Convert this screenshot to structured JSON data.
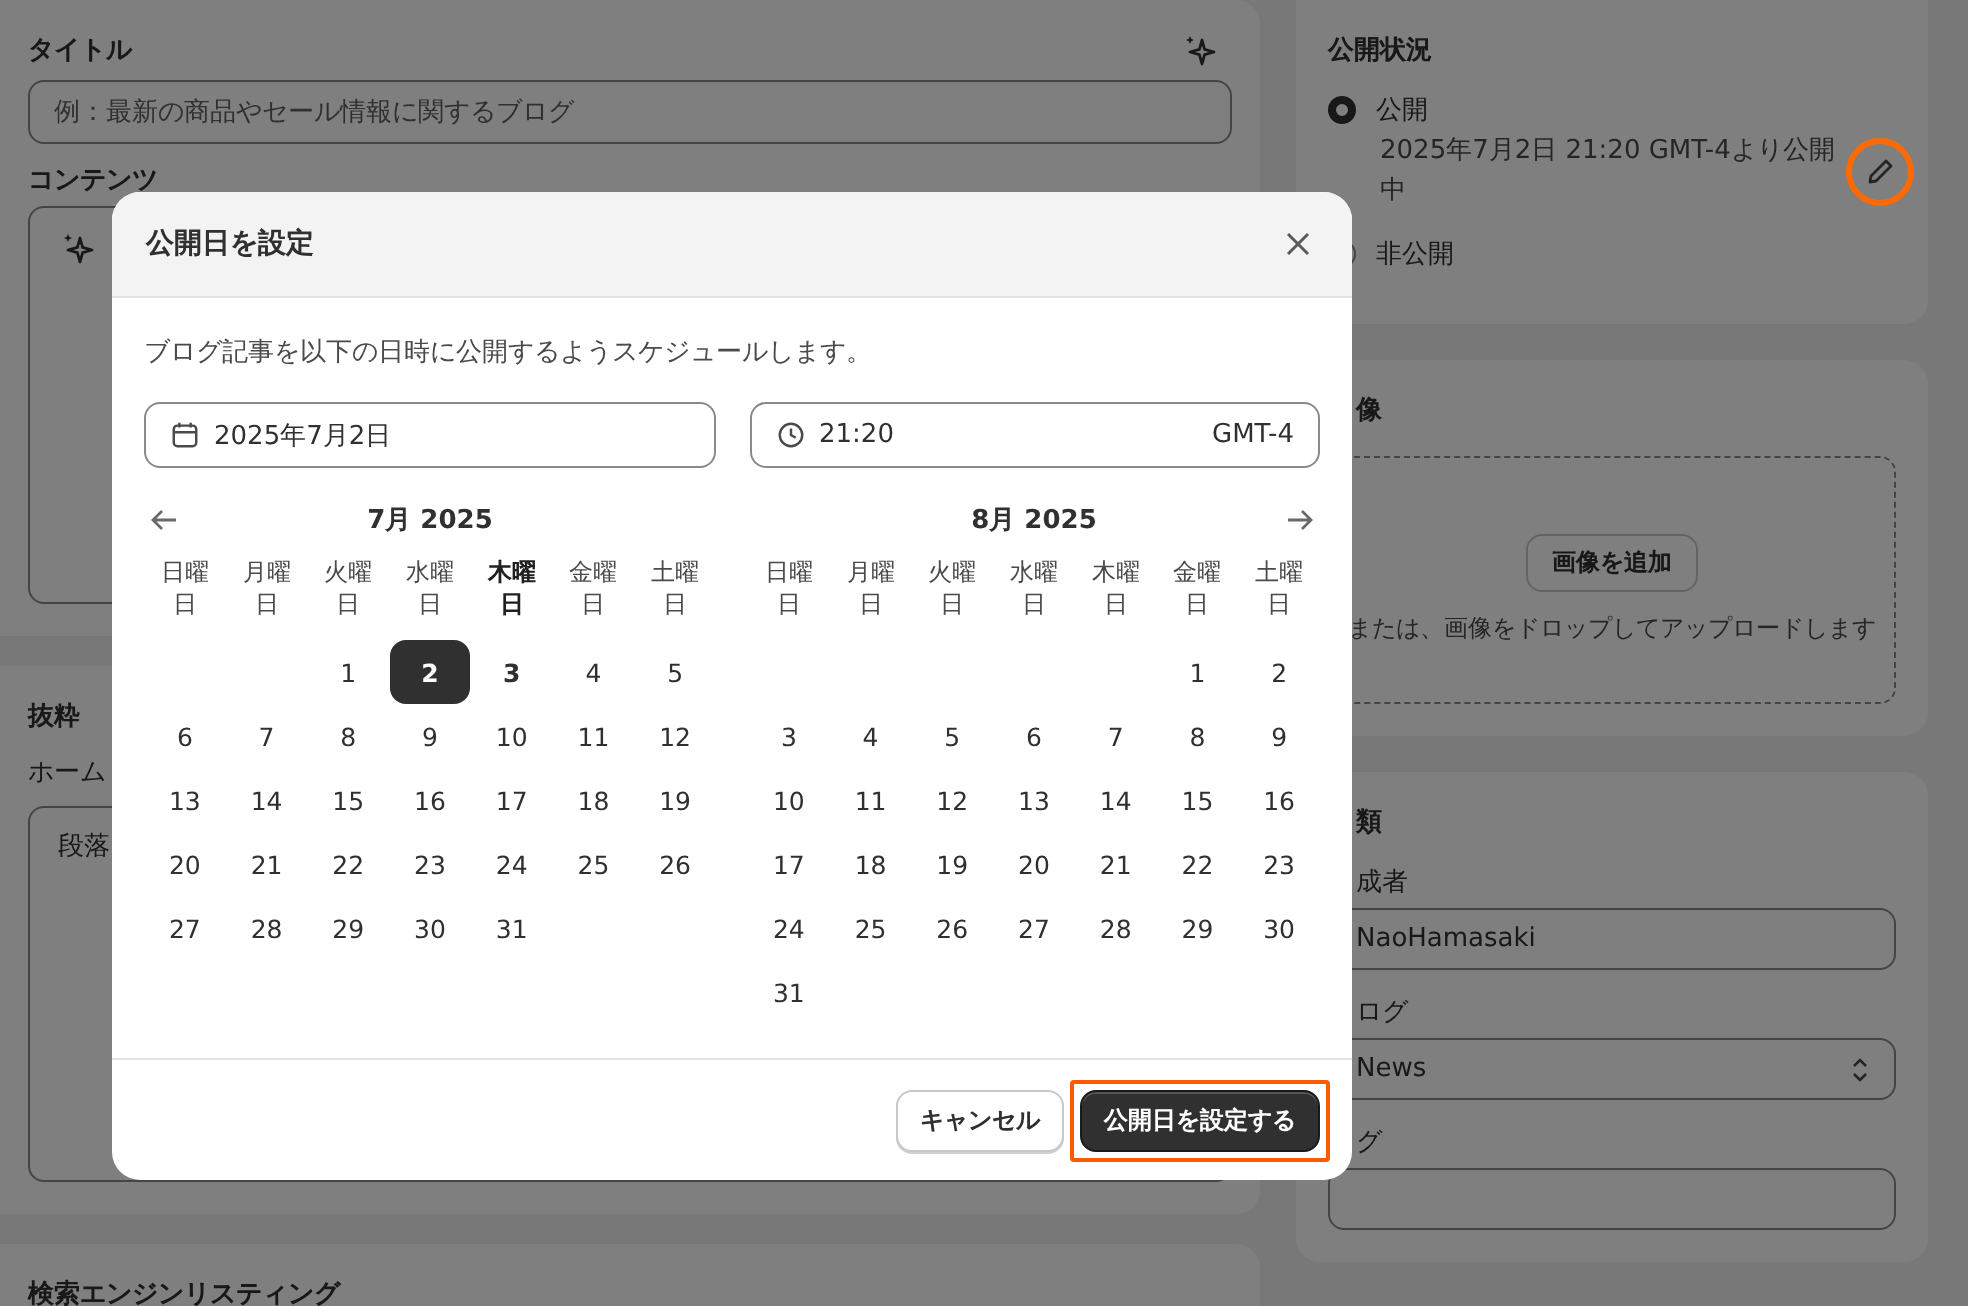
{
  "main": {
    "title_label": "タイトル",
    "title_placeholder": "例：最新の商品やセール情報に関するブログ",
    "content_label": "コンテンツ",
    "excerpt_title": "抜粋",
    "excerpt_hint": "ホーム",
    "excerpt_format": "段落",
    "seo_title": "検索エンジンリスティング"
  },
  "visibility": {
    "title": "公開状況",
    "options": [
      {
        "label": "公開",
        "selected": true,
        "detail": "2025年7月2日 21:20 GMT-4より公開中",
        "edit_highlighted": true
      },
      {
        "label": "非公開",
        "selected": false
      }
    ]
  },
  "image": {
    "title": "像",
    "button": "画像を追加",
    "hint": "または、画像をドロップしてアップロードします"
  },
  "organization": {
    "title": "類",
    "author_label": "成者",
    "author": "NaoHamasaki",
    "blog_label": "ログ",
    "blog": "News",
    "tags_label": "グ"
  },
  "modal": {
    "title": "公開日を設定",
    "description": "ブログ記事を以下の日時に公開するようスケジュールします。",
    "date": "2025年7月2日",
    "time": "21:20",
    "timezone": "GMT-4",
    "months": [
      {
        "title": "7月 2025",
        "weekdays": [
          {
            "label": "日曜日",
            "today": false
          },
          {
            "label": "月曜日",
            "today": false
          },
          {
            "label": "火曜日",
            "today": false
          },
          {
            "label": "水曜日",
            "today": false
          },
          {
            "label": "木曜日",
            "today": true
          },
          {
            "label": "金曜日",
            "today": false
          },
          {
            "label": "土曜日",
            "today": false
          }
        ],
        "weeks": [
          [
            {
              "d": "1",
              "selected": false,
              "today": false
            },
            {
              "d": "2",
              "selected": true,
              "today": false
            },
            {
              "d": "3",
              "selected": false,
              "today": true
            },
            {
              "d": "4",
              "selected": false,
              "today": false
            },
            {
              "d": "5",
              "selected": false,
              "today": false
            }
          ],
          [
            {
              "d": "6",
              "selected": false,
              "today": false
            },
            {
              "d": "7",
              "selected": false,
              "today": false
            },
            {
              "d": "8",
              "selected": false,
              "today": false
            },
            {
              "d": "9",
              "selected": false,
              "today": false
            },
            {
              "d": "10",
              "selected": false,
              "today": false
            },
            {
              "d": "11",
              "selected": false,
              "today": false
            },
            {
              "d": "12",
              "selected": false,
              "today": false
            }
          ],
          [
            {
              "d": "13",
              "selected": false,
              "today": false
            },
            {
              "d": "14",
              "selected": false,
              "today": false
            },
            {
              "d": "15",
              "selected": false,
              "today": false
            },
            {
              "d": "16",
              "selected": false,
              "today": false
            },
            {
              "d": "17",
              "selected": false,
              "today": false
            },
            {
              "d": "18",
              "selected": false,
              "today": false
            },
            {
              "d": "19",
              "selected": false,
              "today": false
            }
          ],
          [
            {
              "d": "20",
              "selected": false,
              "today": false
            },
            {
              "d": "21",
              "selected": false,
              "today": false
            },
            {
              "d": "22",
              "selected": false,
              "today": false
            },
            {
              "d": "23",
              "selected": false,
              "today": false
            },
            {
              "d": "24",
              "selected": false,
              "today": false
            },
            {
              "d": "25",
              "selected": false,
              "today": false
            },
            {
              "d": "26",
              "selected": false,
              "today": false
            }
          ],
          [
            {
              "d": "27",
              "selected": false,
              "today": false
            },
            {
              "d": "28",
              "selected": false,
              "today": false
            },
            {
              "d": "29",
              "selected": false,
              "today": false
            },
            {
              "d": "30",
              "selected": false,
              "today": false
            },
            {
              "d": "31",
              "selected": false,
              "today": false
            }
          ]
        ]
      },
      {
        "title": "8月 2025",
        "weekdays": [
          {
            "label": "日曜日",
            "today": false
          },
          {
            "label": "月曜日",
            "today": false
          },
          {
            "label": "火曜日",
            "today": false
          },
          {
            "label": "水曜日",
            "today": false
          },
          {
            "label": "木曜日",
            "today": false
          },
          {
            "label": "金曜日",
            "today": false
          },
          {
            "label": "土曜日",
            "today": false
          }
        ],
        "weeks": [
          [
            {
              "d": "1",
              "selected": false,
              "today": false
            },
            {
              "d": "2",
              "selected": false,
              "today": false
            }
          ],
          [
            {
              "d": "3",
              "selected": false,
              "today": false
            },
            {
              "d": "4",
              "selected": false,
              "today": false
            },
            {
              "d": "5",
              "selected": false,
              "today": false
            },
            {
              "d": "6",
              "selected": false,
              "today": false
            },
            {
              "d": "7",
              "selected": false,
              "today": false
            },
            {
              "d": "8",
              "selected": false,
              "today": false
            },
            {
              "d": "9",
              "selected": false,
              "today": false
            }
          ],
          [
            {
              "d": "10",
              "selected": false,
              "today": false
            },
            {
              "d": "11",
              "selected": false,
              "today": false
            },
            {
              "d": "12",
              "selected": false,
              "today": false
            },
            {
              "d": "13",
              "selected": false,
              "today": false
            },
            {
              "d": "14",
              "selected": false,
              "today": false
            },
            {
              "d": "15",
              "selected": false,
              "today": false
            },
            {
              "d": "16",
              "selected": false,
              "today": false
            }
          ],
          [
            {
              "d": "17",
              "selected": false,
              "today": false
            },
            {
              "d": "18",
              "selected": false,
              "today": false
            },
            {
              "d": "19",
              "selected": false,
              "today": false
            },
            {
              "d": "20",
              "selected": false,
              "today": false
            },
            {
              "d": "21",
              "selected": false,
              "today": false
            },
            {
              "d": "22",
              "selected": false,
              "today": false
            },
            {
              "d": "23",
              "selected": false,
              "today": false
            }
          ],
          [
            {
              "d": "24",
              "selected": false,
              "today": false
            },
            {
              "d": "25",
              "selected": false,
              "today": false
            },
            {
              "d": "26",
              "selected": false,
              "today": false
            },
            {
              "d": "27",
              "selected": false,
              "today": false
            },
            {
              "d": "28",
              "selected": false,
              "today": false
            },
            {
              "d": "29",
              "selected": false,
              "today": false
            },
            {
              "d": "30",
              "selected": false,
              "today": false
            }
          ],
          [
            {
              "d": "31",
              "selected": false,
              "today": false
            }
          ]
        ]
      }
    ],
    "buttons": [
      {
        "kind": "secondary",
        "label": "キャンセル",
        "highlighted": false
      },
      {
        "kind": "primary",
        "label": "公開日を設定する",
        "highlighted": true
      }
    ]
  }
}
